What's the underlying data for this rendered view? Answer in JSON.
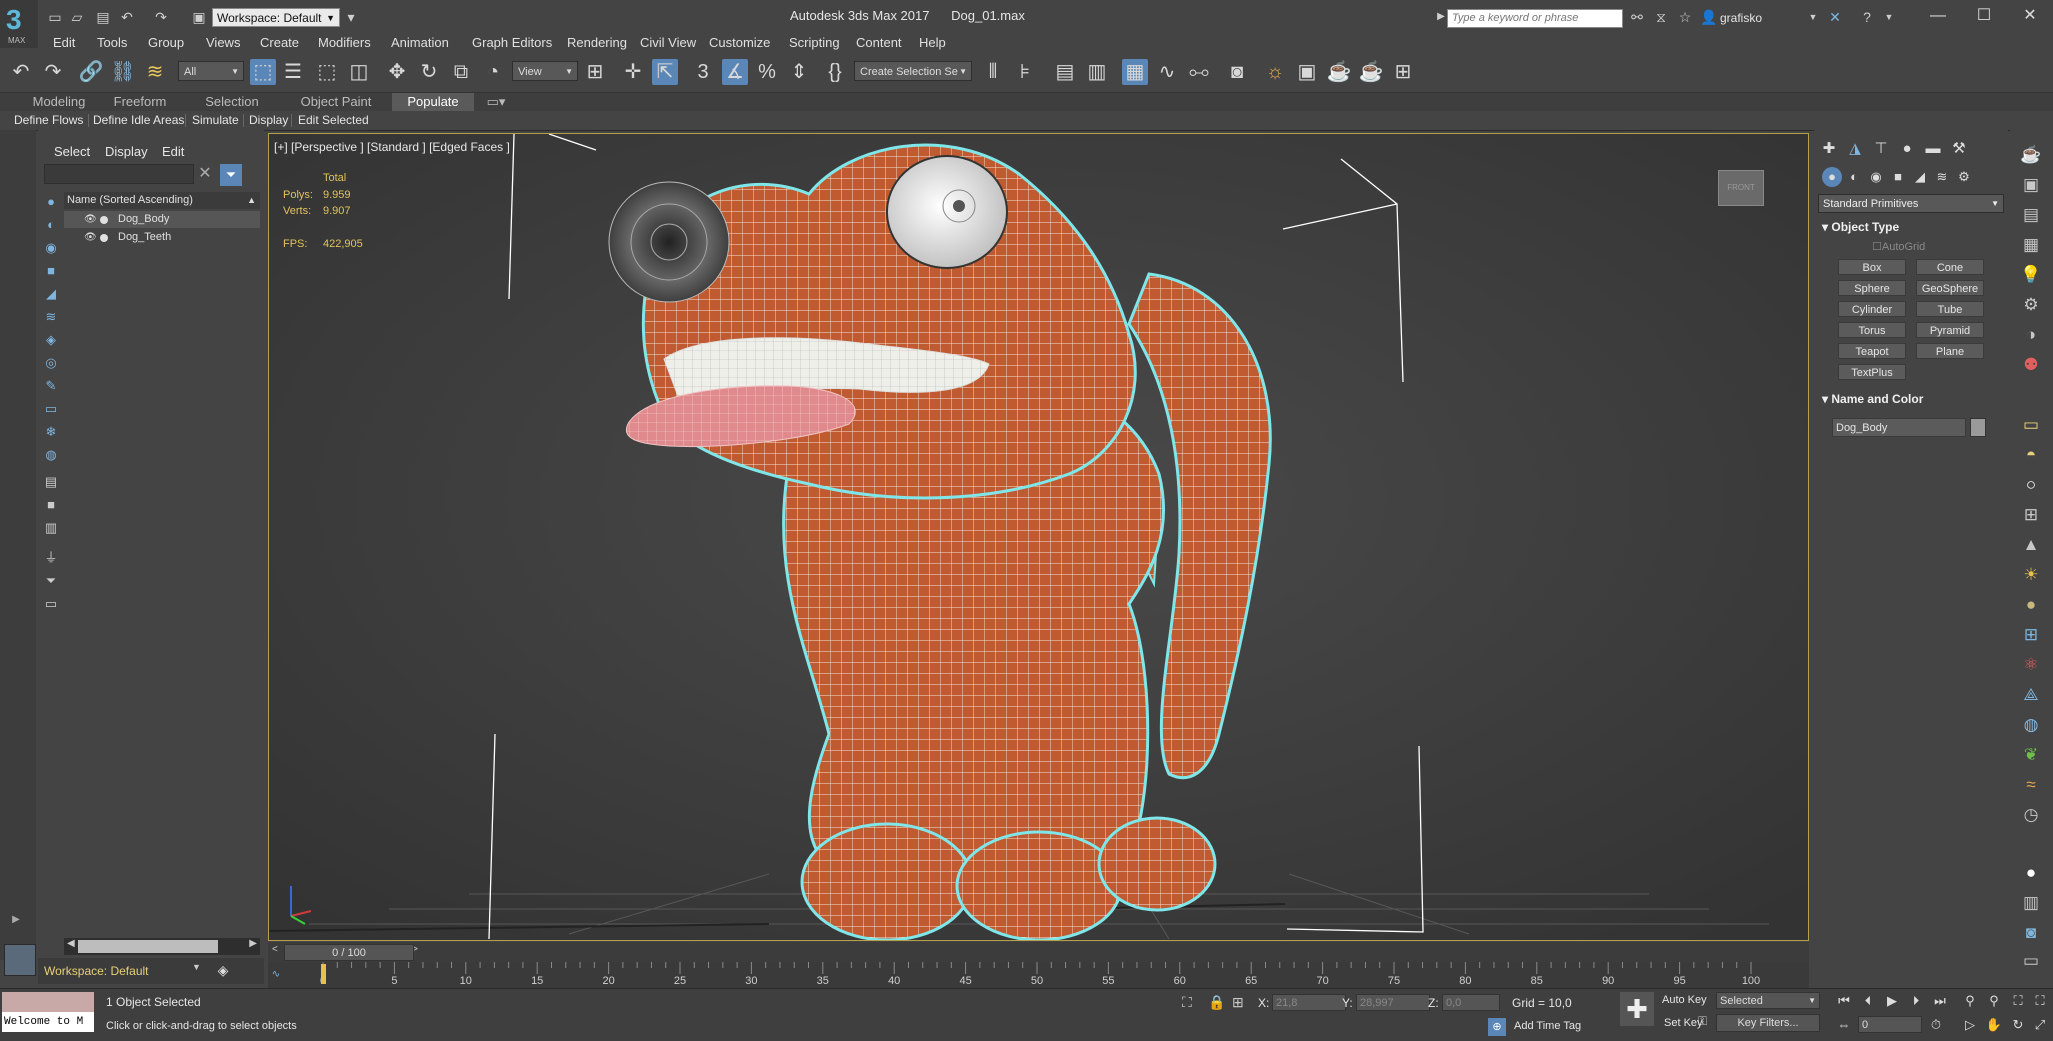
{
  "app": {
    "logo_main": "3",
    "logo_sub": "MAX",
    "title": "Autodesk 3ds Max 2017      Dog_01.max"
  },
  "titlebar": {
    "workspace_value": "Workspace: Default",
    "search_placeholder": "Type a keyword or phrase",
    "user_name": "grafisko",
    "icons": [
      "new-file-icon",
      "open-file-icon",
      "save-file-icon",
      "undo-icon",
      "redo-icon",
      "project-folder-icon",
      "binoculars-icon",
      "bookmark-icon",
      "star-icon",
      "user-icon",
      "exchange-icon",
      "help-icon"
    ]
  },
  "menubar": [
    "Edit",
    "Tools",
    "Group",
    "Views",
    "Create",
    "Modifiers",
    "Animation",
    "Graph Editors",
    "Rendering",
    "Civil View",
    "Customize",
    "Scripting",
    "Content",
    "Help"
  ],
  "toolbar": {
    "selection_filter": "All",
    "ref_coord": "View",
    "named_selection": "Create Selection Se",
    "icons": [
      "undo-icon",
      "redo-icon",
      "link-icon",
      "unlink-icon",
      "bind-spacewarp-icon",
      "select-object-icon",
      "select-by-name-icon",
      "rect-selection-icon",
      "window-crossing-icon",
      "move-icon",
      "rotate-icon",
      "scale-icon",
      "select-place-icon",
      "pivot-icon",
      "keyboard-shortcut-icon",
      "snap-3d-icon",
      "angle-snap-icon",
      "percent-snap-icon",
      "spinner-snap-icon",
      "edit-named-sets-icon",
      "mirror-icon",
      "align-icon",
      "layer-explorer-icon",
      "toggle-ribbon-icon",
      "curve-editor-icon",
      "schematic-view-icon",
      "material-editor-icon",
      "render-setup-icon",
      "rendered-frame-icon",
      "render-icon",
      "render-iterative-icon",
      "render-cloud-icon"
    ]
  },
  "ribbon": {
    "tabs": [
      "Modeling",
      "Freeform",
      "Selection",
      "Object Paint",
      "Populate"
    ],
    "active_tab": "Populate",
    "buttons": [
      "Define Flows",
      "Define Idle Areas",
      "Simulate",
      "Display",
      "Edit Selected"
    ]
  },
  "explorer": {
    "tabs": [
      "Select",
      "Display",
      "Edit"
    ],
    "header": "Name (Sorted Ascending)",
    "rows": [
      {
        "name": "Dog_Body",
        "selected": true
      },
      {
        "name": "Dog_Teeth",
        "selected": false
      }
    ],
    "workspace": "Workspace: Default"
  },
  "viewport": {
    "label": "[+] [Perspective ] [Standard ] [Edged Faces ]",
    "stats": {
      "total_label": "Total",
      "polys_label": "Polys:",
      "polys": "9.959",
      "verts_label": "Verts:",
      "verts": "9.907",
      "fps_label": "FPS:",
      "fps": "422,905"
    },
    "viewcube_label": "FRONT"
  },
  "command_panel": {
    "category": "Standard Primitives",
    "object_type_title": "Object Type",
    "autogrid": "AutoGrid",
    "primitives": [
      "Box",
      "Cone",
      "Sphere",
      "GeoSphere",
      "Cylinder",
      "Tube",
      "Torus",
      "Pyramid",
      "Teapot",
      "Plane",
      "TextPlus"
    ],
    "name_color_title": "Name and Color",
    "object_name": "Dog_Body",
    "object_color": "#9a9a9a"
  },
  "timeline": {
    "frame_display": "0 / 100",
    "ticks": [
      "0",
      "5",
      "10",
      "15",
      "20",
      "25",
      "30",
      "35",
      "40",
      "45",
      "50",
      "55",
      "60",
      "65",
      "70",
      "75",
      "80",
      "85",
      "90",
      "95",
      "100"
    ]
  },
  "statusbar": {
    "maxscript": "Welcome to M",
    "selection_status": "1 Object Selected",
    "prompt": "Click or click-and-drag to select objects",
    "x_label": "X:",
    "x_value": "21,8",
    "y_label": "Y:",
    "y_value": "28,997",
    "z_label": "Z:",
    "z_value": "0,0",
    "grid": "Grid = 10,0",
    "add_time_tag": "Add Time Tag",
    "auto_key": "Auto Key",
    "set_key": "Set Key",
    "key_mode": "Selected",
    "key_filters": "Key Filters...",
    "current_frame": "0"
  },
  "colors": {
    "accent": "#5b87b8",
    "selection_outline": "#7fe6ea",
    "dog_body": "#c05a30",
    "stats": "#e2c25c",
    "workspace_text": "#e8d07a"
  }
}
